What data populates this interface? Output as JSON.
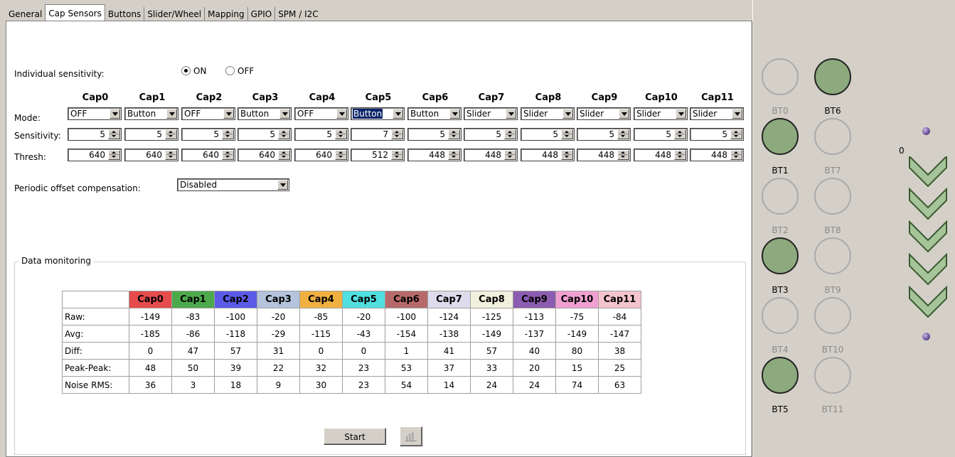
{
  "tabs": [
    "General",
    "Cap Sensors",
    "Buttons",
    "Slider/Wheel",
    "Mapping",
    "GPIO",
    "SPM / I2C"
  ],
  "active_tab": "Cap Sensors",
  "individual_sensitivity": {
    "label": "Individual sensitivity:",
    "on_label": "ON",
    "off_label": "OFF",
    "selected": "ON"
  },
  "caps": [
    "Cap0",
    "Cap1",
    "Cap2",
    "Cap3",
    "Cap4",
    "Cap5",
    "Cap6",
    "Cap7",
    "Cap8",
    "Cap9",
    "Cap10",
    "Cap11"
  ],
  "row_labels": {
    "mode": "Mode:",
    "sensitivity": "Sensitivity:",
    "thresh": "Thresh:"
  },
  "modes": [
    "OFF",
    "Button",
    "OFF",
    "Button",
    "OFF",
    "Button",
    "Button",
    "Slider",
    "Slider",
    "Slider",
    "Slider",
    "Slider"
  ],
  "selected_mode_index": 5,
  "sensitivities": [
    "5",
    "5",
    "5",
    "5",
    "5",
    "7",
    "5",
    "5",
    "5",
    "5",
    "5",
    "5"
  ],
  "thresholds": [
    "640",
    "640",
    "640",
    "640",
    "640",
    "512",
    "448",
    "448",
    "448",
    "448",
    "448",
    "448"
  ],
  "offset_comp": {
    "label": "Periodic offset compensation:",
    "value": "Disabled"
  },
  "monitoring": {
    "title": "Data monitoring",
    "header_colors": [
      "#e74c4c",
      "#4caa4c",
      "#5b5be8",
      "#b4c4dc",
      "#f0b040",
      "#50e0e0",
      "#b86a6a",
      "#dcdcec",
      "#f0f0dc",
      "#8c5cb0",
      "#f0a0d0",
      "#f4c4cc"
    ],
    "rows": [
      {
        "label": "Raw:",
        "values": [
          "-149",
          "-83",
          "-100",
          "-20",
          "-85",
          "-20",
          "-100",
          "-124",
          "-125",
          "-113",
          "-75",
          "-84"
        ]
      },
      {
        "label": "Avg:",
        "values": [
          "-185",
          "-86",
          "-118",
          "-29",
          "-115",
          "-43",
          "-154",
          "-138",
          "-149",
          "-137",
          "-149",
          "-147"
        ]
      },
      {
        "label": "Diff:",
        "values": [
          "0",
          "47",
          "57",
          "31",
          "0",
          "0",
          "1",
          "41",
          "57",
          "40",
          "80",
          "38"
        ]
      },
      {
        "label": "Peak-Peak:",
        "values": [
          "48",
          "50",
          "39",
          "22",
          "32",
          "23",
          "53",
          "37",
          "33",
          "20",
          "15",
          "25"
        ]
      },
      {
        "label": "Noise RMS:",
        "values": [
          "36",
          "3",
          "18",
          "9",
          "30",
          "23",
          "54",
          "14",
          "24",
          "24",
          "74",
          "63"
        ]
      }
    ],
    "start_label": "Start",
    "chart_icon": "bar-chart-icon"
  },
  "buttons_panel": [
    {
      "label": "BT0",
      "on": false
    },
    {
      "label": "BT6",
      "on": true
    },
    {
      "label": "BT1",
      "on": true
    },
    {
      "label": "BT7",
      "on": false
    },
    {
      "label": "BT2",
      "on": false
    },
    {
      "label": "BT8",
      "on": false
    },
    {
      "label": "BT3",
      "on": true
    },
    {
      "label": "BT9",
      "on": false
    },
    {
      "label": "BT4",
      "on": false
    },
    {
      "label": "BT10",
      "on": false
    },
    {
      "label": "BT5",
      "on": true
    },
    {
      "label": "BT11",
      "on": false
    }
  ],
  "slider": {
    "value_label": "0",
    "chevron_count": 5,
    "chevron_color": "#a6c49a"
  }
}
